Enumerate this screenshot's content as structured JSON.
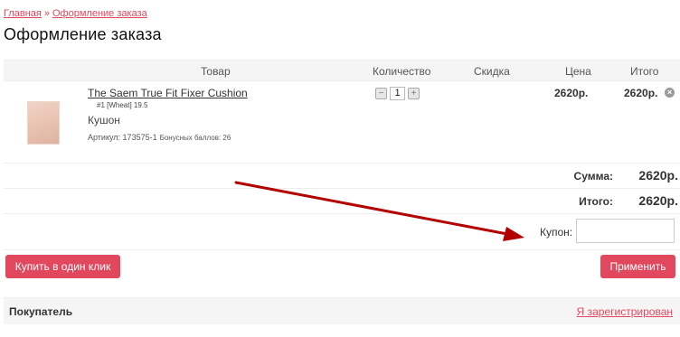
{
  "breadcrumb": {
    "home": "Главная",
    "separator": "»",
    "current": "Оформление заказа"
  },
  "page_title": "Оформление заказа",
  "table": {
    "headers": {
      "product": "Товар",
      "quantity": "Количество",
      "discount": "Скидка",
      "price": "Цена",
      "total": "Итого"
    }
  },
  "item": {
    "name": "The Saem True Fit Fixer Cushion",
    "variant": "#1 [Wheat] 19.5",
    "type": "Кушон",
    "article": "Артикул: 173575-1",
    "bonus": "Бонусных баллов: 26",
    "quantity": "1",
    "minus": "−",
    "plus": "+",
    "price": "2620р.",
    "total": "2620р.",
    "remove": "×"
  },
  "summary": {
    "sum_label": "Сумма:",
    "sum_value": "2620р.",
    "total_label": "Итого:",
    "total_value": "2620р."
  },
  "coupon": {
    "label": "Купон:",
    "value": ""
  },
  "buttons": {
    "buy_one_click": "Купить в один клик",
    "apply": "Применить"
  },
  "buyer": {
    "title": "Покупатель",
    "registered_link": "Я зарегистрирован"
  },
  "colors": {
    "accent": "#e2485d",
    "arrow": "#b30000",
    "header_bg": "#f5f5f5"
  }
}
